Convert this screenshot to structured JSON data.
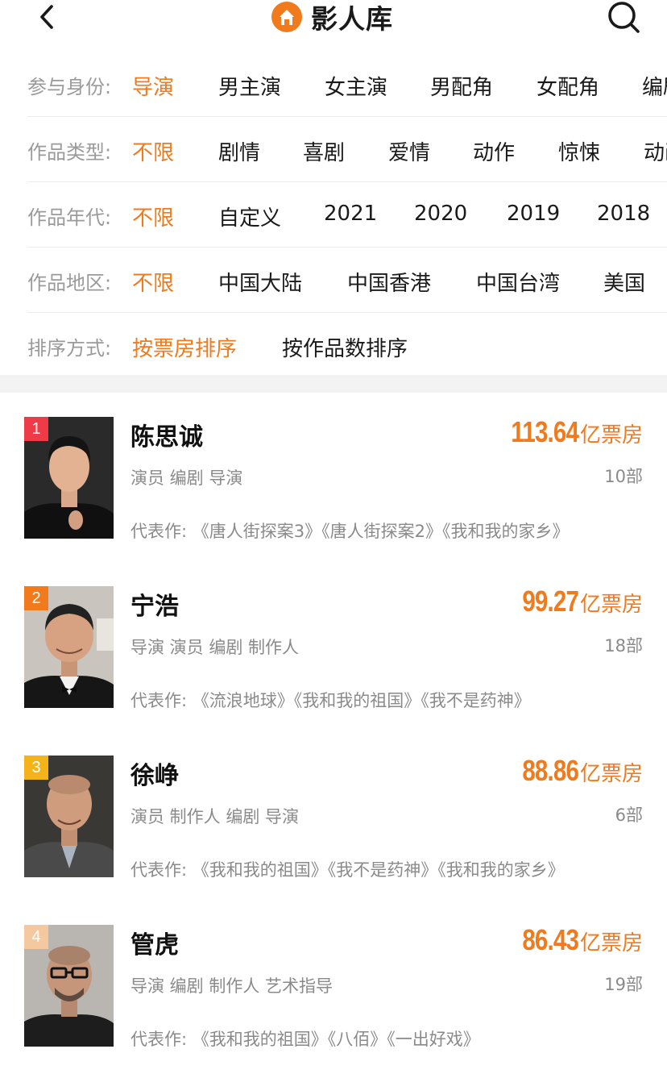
{
  "header": {
    "title": "影人库"
  },
  "filters": [
    {
      "label": "参与身份:",
      "options": [
        "导演",
        "男主演",
        "女主演",
        "男配角",
        "女配角",
        "编剧"
      ]
    },
    {
      "label": "作品类型:",
      "options": [
        "不限",
        "剧情",
        "喜剧",
        "爱情",
        "动作",
        "惊悚",
        "动画"
      ]
    },
    {
      "label": "作品年代:",
      "options": [
        "不限",
        "自定义",
        "2021",
        "2020",
        "2019",
        "2018"
      ]
    },
    {
      "label": "作品地区:",
      "options": [
        "不限",
        "中国大陆",
        "中国香港",
        "中国台湾",
        "美国"
      ]
    },
    {
      "label": "排序方式:",
      "options": [
        "按票房排序",
        "按作品数排序"
      ]
    }
  ],
  "people": [
    {
      "rank": "1",
      "name": "陈思诚",
      "box_office": "113.64",
      "box_unit": "亿票房",
      "roles": "演员 编剧 导演",
      "works": "10部",
      "rep_label": "代表作:",
      "rep": "《唐人街探案3》《唐人街探案2》《我和我的家乡》",
      "rank_color": "#ee3b47"
    },
    {
      "rank": "2",
      "name": "宁浩",
      "box_office": "99.27",
      "box_unit": "亿票房",
      "roles": "导演 演员 编剧 制作人",
      "works": "18部",
      "rep_label": "代表作:",
      "rep": "《流浪地球》《我和我的祖国》《我不是药神》",
      "rank_color": "#f07a1c"
    },
    {
      "rank": "3",
      "name": "徐峥",
      "box_office": "88.86",
      "box_unit": "亿票房",
      "roles": "演员 制作人 编剧 导演",
      "works": "6部",
      "rep_label": "代表作:",
      "rep": "《我和我的祖国》《我不是药神》《我和我的家乡》",
      "rank_color": "#f5b31a"
    },
    {
      "rank": "4",
      "name": "管虎",
      "box_office": "86.43",
      "box_unit": "亿票房",
      "roles": "导演 编剧 制作人 艺术指导",
      "works": "19部",
      "rep_label": "代表作:",
      "rep": "《我和我的祖国》《八佰》《一出好戏》",
      "rank_color": "#f4c9a0"
    }
  ]
}
